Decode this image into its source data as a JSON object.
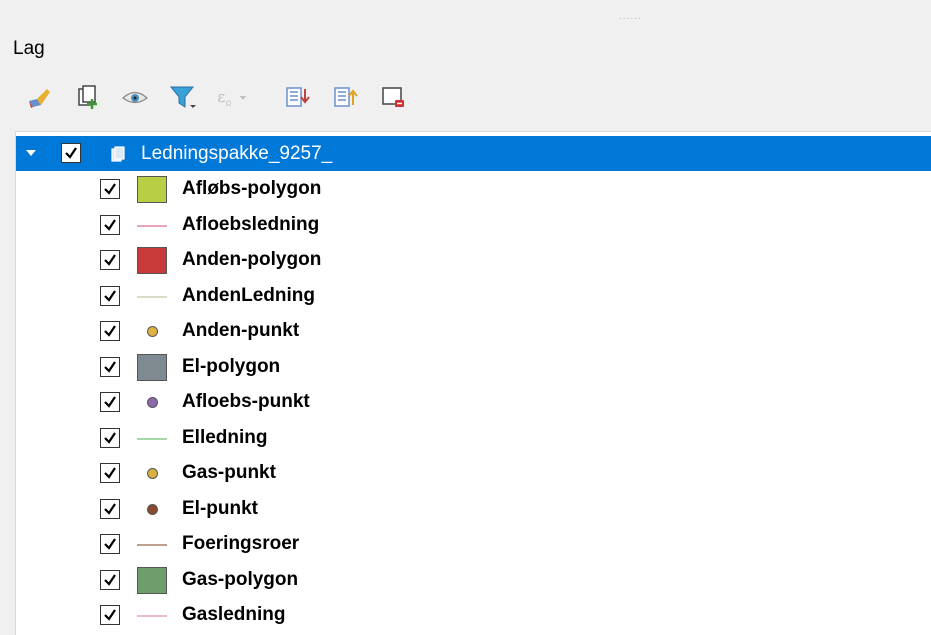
{
  "panel": {
    "title": "Lag"
  },
  "toolbar": {
    "buttons": [
      {
        "name": "style-manager",
        "icon": "paintbrush-icon"
      },
      {
        "name": "add-group",
        "icon": "add-group-icon"
      },
      {
        "name": "manage-themes",
        "icon": "eye-icon"
      },
      {
        "name": "filter-legend",
        "icon": "filter-icon"
      },
      {
        "name": "filter-expression",
        "icon": "expression-filter-icon"
      },
      {
        "name": "expand-all",
        "icon": "expand-all-icon"
      },
      {
        "name": "collapse-all",
        "icon": "collapse-all-icon"
      },
      {
        "name": "remove-layer",
        "icon": "remove-layer-icon"
      }
    ]
  },
  "tree": {
    "group": {
      "label": "Ledningspakke_9257_",
      "checked": true,
      "expanded": true
    },
    "layers": [
      {
        "label": "Afløbs-polygon",
        "symbol": "fill",
        "color": "#b8cf45",
        "checked": true
      },
      {
        "label": "Afloebsledning",
        "symbol": "line",
        "color": "#e8a6c0",
        "checked": true
      },
      {
        "label": "Anden-polygon",
        "symbol": "fill",
        "color": "#c8393a",
        "checked": true
      },
      {
        "label": "AndenLedning",
        "symbol": "line",
        "color": "#d8dccb",
        "checked": true
      },
      {
        "label": "Anden-punkt",
        "symbol": "point",
        "color": "#e0b040",
        "checked": true
      },
      {
        "label": "El-polygon",
        "symbol": "fill",
        "color": "#7f8a90",
        "checked": true
      },
      {
        "label": "Afloebs-punkt",
        "symbol": "point",
        "color": "#8a6aa8",
        "checked": true
      },
      {
        "label": "Elledning",
        "symbol": "line",
        "color": "#a8d8a8",
        "checked": true
      },
      {
        "label": "Gas-punkt",
        "symbol": "point",
        "color": "#d8b040",
        "checked": true
      },
      {
        "label": "El-punkt",
        "symbol": "point",
        "color": "#8a4a30",
        "checked": true
      },
      {
        "label": "Foeringsroer",
        "symbol": "line",
        "color": "#c0a090",
        "checked": true
      },
      {
        "label": "Gas-polygon",
        "symbol": "fill",
        "color": "#6f9e6a",
        "checked": true
      },
      {
        "label": "Gasledning",
        "symbol": "line",
        "color": "#f0b8c8",
        "checked": true
      }
    ]
  }
}
